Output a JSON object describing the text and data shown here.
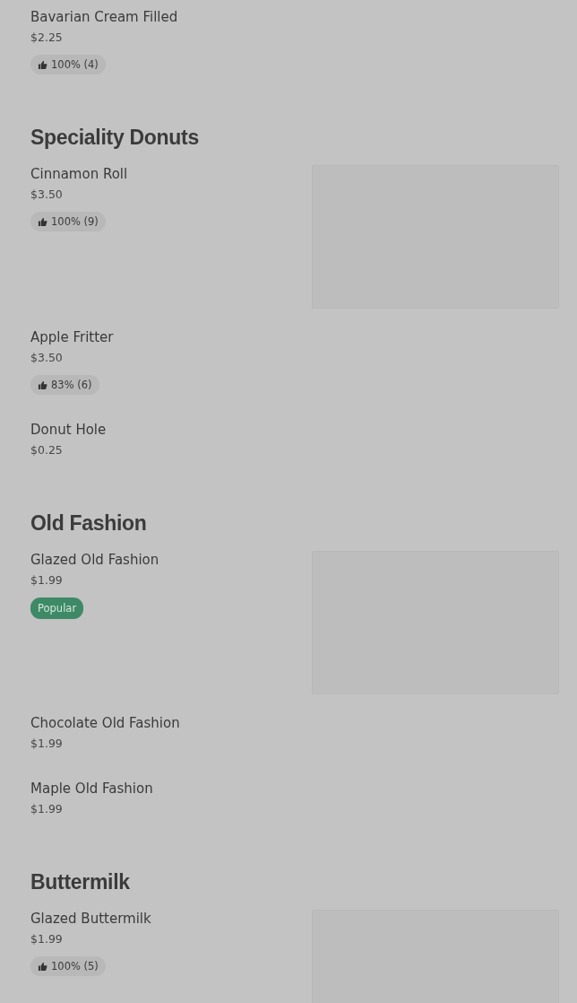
{
  "sections": [
    {
      "items": [
        {
          "name": "Bavarian Cream Filled",
          "price": "$2.25",
          "badge": {
            "kind": "rating",
            "text": "100% (4)"
          },
          "has_image": false
        }
      ]
    },
    {
      "title": "Speciality Donuts",
      "items": [
        {
          "name": "Cinnamon Roll",
          "price": "$3.50",
          "badge": {
            "kind": "rating",
            "text": "100% (9)"
          },
          "has_image": true
        },
        {
          "name": "Apple Fritter",
          "price": "$3.50",
          "badge": {
            "kind": "rating",
            "text": "83% (6)"
          },
          "has_image": false
        },
        {
          "name": "Donut Hole",
          "price": "$0.25",
          "has_image": false
        }
      ]
    },
    {
      "title": "Old Fashion",
      "items": [
        {
          "name": "Glazed Old Fashion",
          "price": "$1.99",
          "badge": {
            "kind": "popular",
            "text": "Popular"
          },
          "has_image": true
        },
        {
          "name": "Chocolate Old Fashion",
          "price": "$1.99",
          "has_image": false
        },
        {
          "name": "Maple Old Fashion",
          "price": "$1.99",
          "has_image": false
        }
      ]
    },
    {
      "title": "Buttermilk",
      "items": [
        {
          "name": "Glazed Buttermilk",
          "price": "$1.99",
          "badge": {
            "kind": "rating",
            "text": "100% (5)"
          },
          "has_image": true
        }
      ]
    }
  ]
}
